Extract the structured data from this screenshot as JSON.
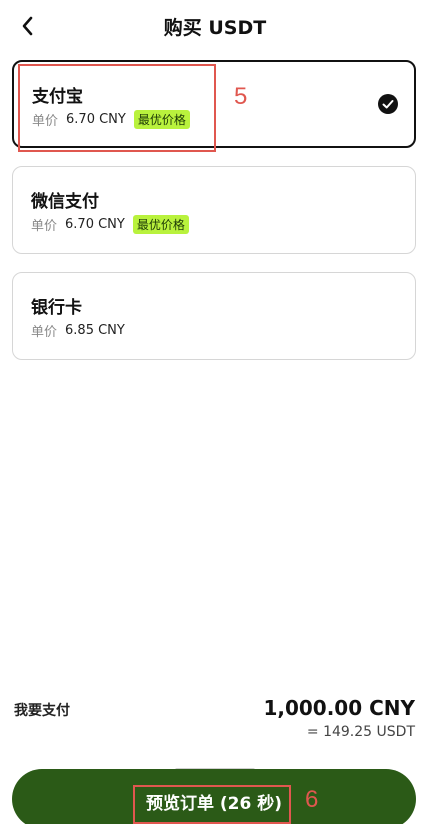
{
  "header": {
    "title": "购买 USDT",
    "back_icon": "chevron-left-icon"
  },
  "methods": [
    {
      "name": "支付宝",
      "price_label": "单价",
      "price": "6.70 CNY",
      "badge": "最优价格",
      "selected": true
    },
    {
      "name": "微信支付",
      "price_label": "单价",
      "price": "6.70 CNY",
      "badge": "最优价格",
      "selected": false
    },
    {
      "name": "银行卡",
      "price_label": "单价",
      "price": "6.85 CNY",
      "badge": "",
      "selected": false
    }
  ],
  "payment": {
    "label": "我要支付",
    "amount": "1,000.00 CNY",
    "equivalent": "= 149.25 USDT"
  },
  "cta": {
    "label": "预览订单 (26 秒)"
  },
  "annotations": {
    "first": "5",
    "second": "6",
    "color": "#e0574f"
  },
  "colors": {
    "cta": "#2b5a17",
    "badge": "#b9f23d",
    "selected_border": "#111111"
  }
}
